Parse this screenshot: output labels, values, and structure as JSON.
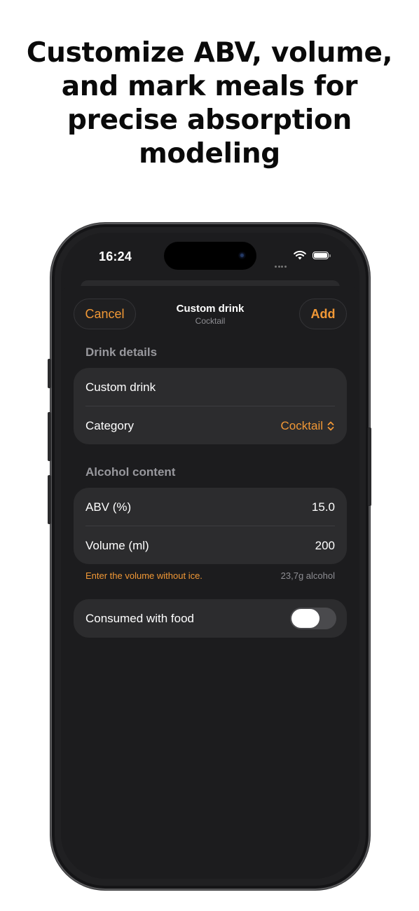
{
  "headline": {
    "lines": [
      "Customize ABV, volume,",
      "and mark meals for",
      "precise absorption",
      "modeling"
    ]
  },
  "status_bar": {
    "time": "16:24"
  },
  "nav": {
    "cancel_label": "Cancel",
    "title": "Custom drink",
    "subtitle": "Cocktail",
    "add_label": "Add"
  },
  "drink_details": {
    "header": "Drink details",
    "name_value": "Custom drink",
    "category_label": "Category",
    "category_value": "Cocktail"
  },
  "alcohol_content": {
    "header": "Alcohol content",
    "abv_label": "ABV (%)",
    "abv_value": "15.0",
    "volume_label": "Volume (ml)",
    "volume_value": "200",
    "note": "Enter the volume without ice.",
    "alcohol_grams": "23,7g alcohol"
  },
  "food": {
    "label": "Consumed with food",
    "toggle_on": false
  },
  "colors": {
    "accent": "#f19836",
    "background": "#1c1c1e",
    "card": "#2c2c2e"
  },
  "icons": [
    "wifi-icon",
    "battery-icon",
    "chevron-up-down-icon",
    "camera-icon"
  ]
}
